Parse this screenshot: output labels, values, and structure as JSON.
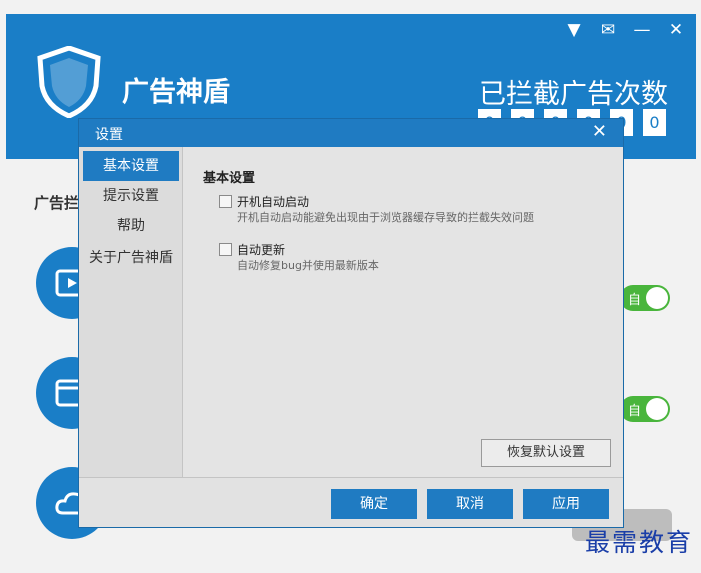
{
  "app": {
    "title": "广告神盾",
    "blocked_title": "已拦截广告次数",
    "counter_digits": [
      "0",
      "0",
      "0",
      "0",
      "0",
      "0"
    ],
    "win_controls": [
      {
        "name": "menu-icon",
        "glyph": "▼"
      },
      {
        "name": "mail-icon",
        "glyph": "✉"
      },
      {
        "name": "minimize-icon",
        "glyph": "—"
      },
      {
        "name": "close-icon",
        "glyph": "✕"
      }
    ],
    "side_label": "广告拦",
    "toggle_text": "自"
  },
  "dialog": {
    "title": "设置",
    "close_glyph": "✕",
    "nav": [
      {
        "label": "基本设置",
        "active": true
      },
      {
        "label": "提示设置",
        "active": false
      },
      {
        "label": "帮助",
        "active": false
      },
      {
        "label": "关于广告神盾",
        "active": false
      }
    ],
    "section_title": "基本设置",
    "options": [
      {
        "label": "开机自动启动",
        "desc": "开机自动启动能避免出现由于浏览器缓存导致的拦截失效问题",
        "checked": false
      },
      {
        "label": "自动更新",
        "desc": "自动修复bug并使用最新版本",
        "checked": false
      }
    ],
    "restore_label": "恢复默认设置",
    "buttons": {
      "ok": "确定",
      "cancel": "取消",
      "apply": "应用"
    }
  },
  "watermark": "最需教育",
  "colors": {
    "brand_blue": "#1a7ec7",
    "dialog_blue": "#1f7bc2",
    "toggle_green": "#49b53c"
  }
}
